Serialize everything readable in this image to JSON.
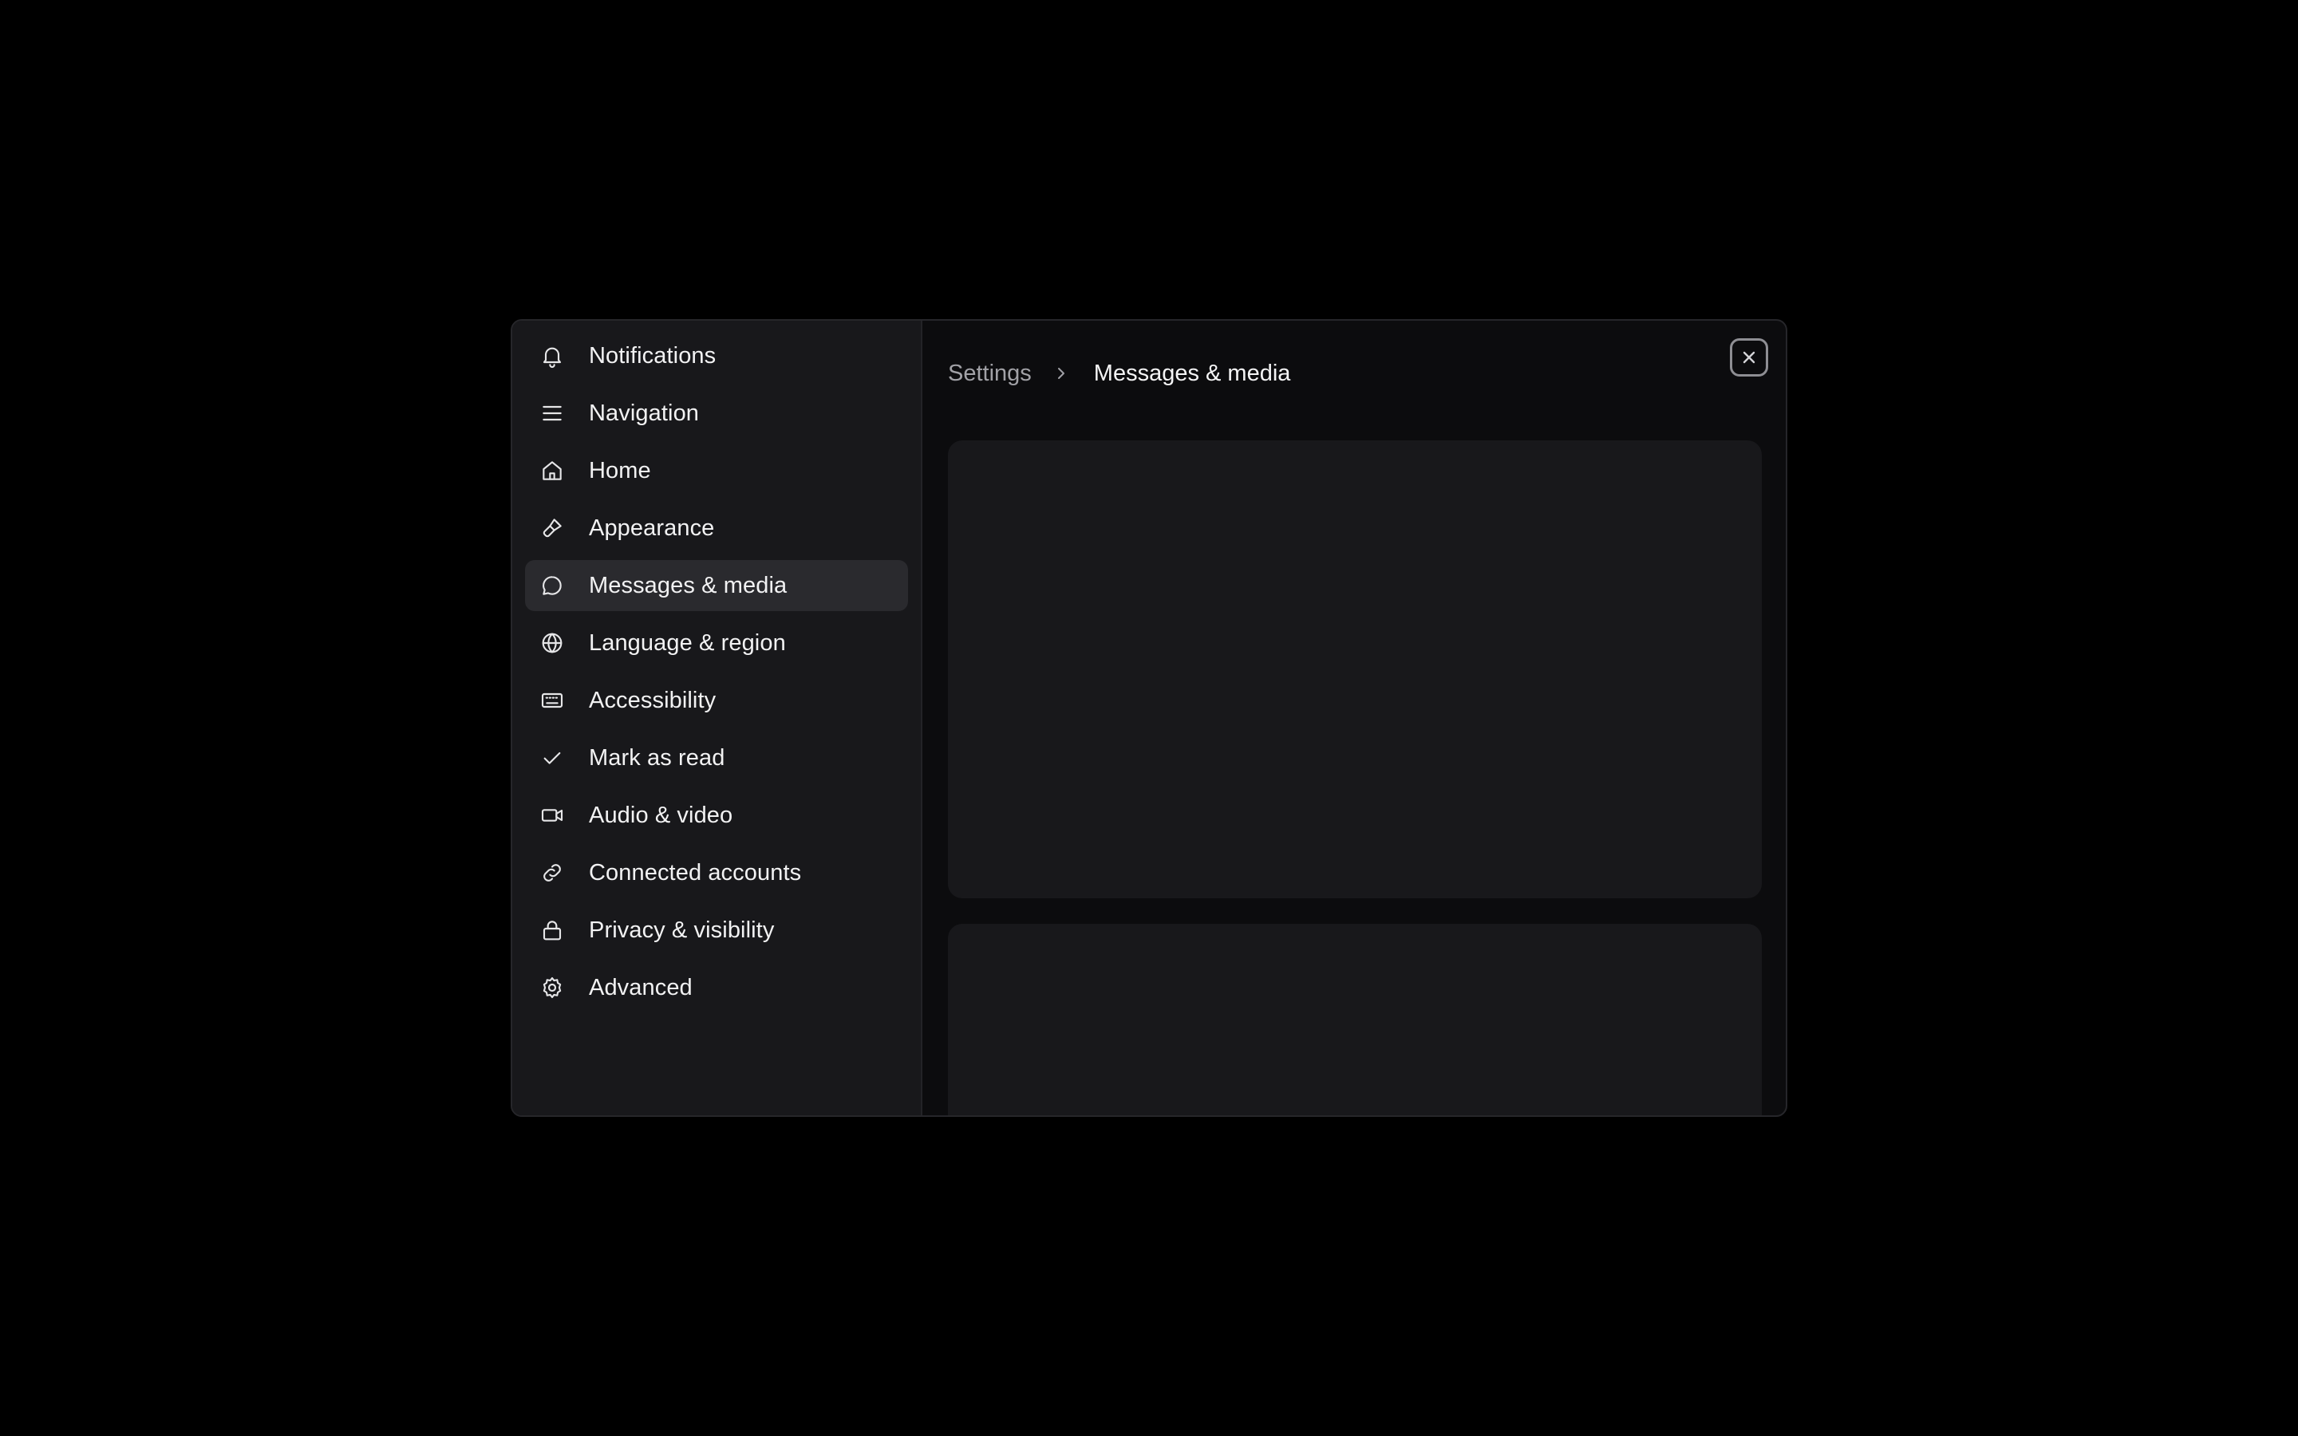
{
  "sidebar": {
    "items": [
      {
        "label": "Notifications",
        "icon": "bell-icon",
        "active": false
      },
      {
        "label": "Navigation",
        "icon": "menu-icon",
        "active": false
      },
      {
        "label": "Home",
        "icon": "home-icon",
        "active": false
      },
      {
        "label": "Appearance",
        "icon": "paintbrush-icon",
        "active": false
      },
      {
        "label": "Messages & media",
        "icon": "message-icon",
        "active": true
      },
      {
        "label": "Language & region",
        "icon": "globe-icon",
        "active": false
      },
      {
        "label": "Accessibility",
        "icon": "keyboard-icon",
        "active": false
      },
      {
        "label": "Mark as read",
        "icon": "check-icon",
        "active": false
      },
      {
        "label": "Audio & video",
        "icon": "video-icon",
        "active": false
      },
      {
        "label": "Connected accounts",
        "icon": "link-icon",
        "active": false
      },
      {
        "label": "Privacy & visibility",
        "icon": "lock-icon",
        "active": false
      },
      {
        "label": "Advanced",
        "icon": "gear-icon",
        "active": false
      }
    ]
  },
  "breadcrumb": {
    "root": "Settings",
    "current": "Messages & media"
  },
  "colors": {
    "background": "#000000",
    "modal": "#0c0c0e",
    "sidebar": "#18181b",
    "active_item": "#2a2a2e",
    "card": "#18181b"
  }
}
